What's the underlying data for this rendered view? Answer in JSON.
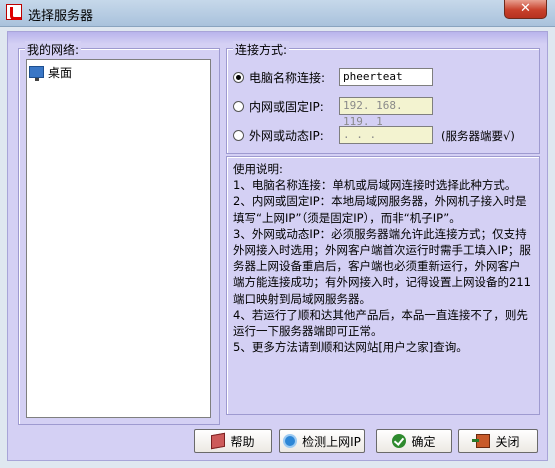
{
  "window": {
    "title": "选择服务器",
    "close_glyph": "✕"
  },
  "network_group": {
    "legend": "我的网络:",
    "tree_items": [
      {
        "label": "桌面",
        "icon": "desktop-icon"
      }
    ]
  },
  "connection_group": {
    "legend": "连接方式:",
    "options": [
      {
        "label": "电脑名称连接:",
        "checked": true,
        "value": "pheerteat",
        "enabled": true
      },
      {
        "label": "内网或固定IP:",
        "checked": false,
        "value": "192. 168. 119. 1",
        "enabled": false
      },
      {
        "label": "外网或动态IP:",
        "checked": false,
        "value": ".      .      .",
        "enabled": false
      }
    ],
    "external_hint": "(服务器端要√)"
  },
  "usage_group": {
    "legend": "使用说明:",
    "lines": [
      "1、电脑名称连接：单机或局域网连接时选择此种方式。",
      "2、内网或固定IP：本地局域网服务器，外网机子接入时是填写“上网IP”（须是固定IP），而非“机子IP”。",
      "3、外网或动态IP：必须服务器端允许此连接方式；仅支持外网接入时选用；外网客户端首次运行时需手工填入IP；服务器上网设备重启后，客户端也必须重新运行，外网客户端方能连接成功；有外网接入时，记得设置上网设备的211端口映射到局域网服务器。",
      "4、若运行了顺和达其他产品后，本品一直连接不了，则先运行一下服务器端即可正常。",
      "5、更多方法请到顺和达网站[用户之家]查询。"
    ]
  },
  "buttons": {
    "help": "帮助",
    "check_ip": "检测上网IP",
    "ok": "确定",
    "close": "关闭"
  }
}
